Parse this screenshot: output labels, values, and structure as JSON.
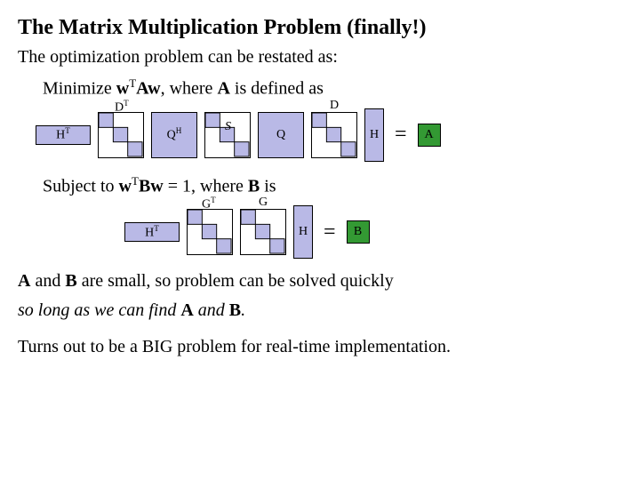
{
  "title": "The Matrix Multiplication Problem (finally!)",
  "intro": "The optimization problem can be restated as:",
  "minimize_pre": "Minimize ",
  "minimize_expr": "w",
  "minimize_T1": "T",
  "minimize_mid": "Aw",
  "minimize_post": ", where ",
  "minimize_A": "A",
  "minimize_tail": " is defined as",
  "row1": {
    "HT": "H",
    "HT_sup": "T",
    "DT": "D",
    "DT_sup": "T",
    "QH": "Q",
    "QH_sup": "H",
    "S": "S",
    "Q": "Q",
    "D": "D",
    "H": "H",
    "eq": "=",
    "A": "A"
  },
  "subject_pre": "Subject to ",
  "subject_w": "w",
  "subject_T": "T",
  "subject_Bw": "Bw",
  "subject_mid": " = 1, where ",
  "subject_B": "B",
  "subject_tail": " is",
  "row2": {
    "HT": "H",
    "HT_sup": "T",
    "GT": "G",
    "GT_sup": "T",
    "G": "G",
    "H": "H",
    "eq": "=",
    "B": "B"
  },
  "small_pre": "A",
  "small_mid1": " and ",
  "small_B": "B",
  "small_txt": " are small, so problem can be solved quickly",
  "small_txt2": "so long as we can find ",
  "small_A2": "A",
  "small_mid2": " and ",
  "small_B2": "B",
  "small_tail": ".",
  "big": "Turns out to be a BIG problem for real-time implementation."
}
